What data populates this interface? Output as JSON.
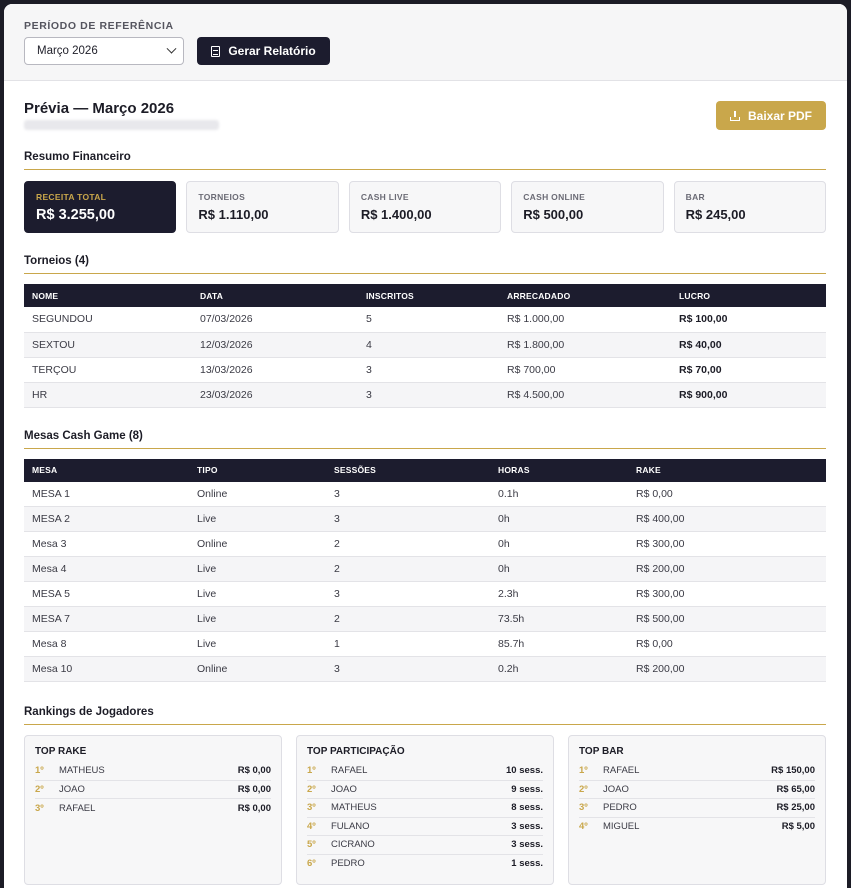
{
  "header": {
    "period_label": "PERÍODO DE REFERÊNCIA",
    "period_value": "Março 2026",
    "generate_label": "Gerar Relatório"
  },
  "preview": {
    "title": "Prévia — Março 2026",
    "pdf_label": "Baixar PDF"
  },
  "summary": {
    "title": "Resumo Financeiro",
    "cards": [
      {
        "label": "RECEITA TOTAL",
        "value": "R$ 3.255,00"
      },
      {
        "label": "TORNEIOS",
        "value": "R$ 1.110,00"
      },
      {
        "label": "CASH LIVE",
        "value": "R$ 1.400,00"
      },
      {
        "label": "CASH ONLINE",
        "value": "R$ 500,00"
      },
      {
        "label": "BAR",
        "value": "R$ 245,00"
      }
    ]
  },
  "tournaments": {
    "title": "Torneios (4)",
    "headers": [
      "NOME",
      "DATA",
      "INSCRITOS",
      "ARRECADADO",
      "LUCRO"
    ],
    "rows": [
      [
        "SEGUNDOU",
        "07/03/2026",
        "5",
        "R$ 1.000,00",
        "R$ 100,00"
      ],
      [
        "SEXTOU",
        "12/03/2026",
        "4",
        "R$ 1.800,00",
        "R$ 40,00"
      ],
      [
        "TERÇOU",
        "13/03/2026",
        "3",
        "R$ 700,00",
        "R$ 70,00"
      ],
      [
        "HR",
        "23/03/2026",
        "3",
        "R$ 4.500,00",
        "R$ 900,00"
      ]
    ]
  },
  "cash_tables": {
    "title": "Mesas Cash Game (8)",
    "headers": [
      "MESA",
      "TIPO",
      "SESSÕES",
      "HORAS",
      "RAKE"
    ],
    "rows": [
      [
        "MESA 1",
        "Online",
        "3",
        "0.1h",
        "R$ 0,00"
      ],
      [
        "MESA 2",
        "Live",
        "3",
        "0h",
        "R$ 400,00"
      ],
      [
        "Mesa 3",
        "Online",
        "2",
        "0h",
        "R$ 300,00"
      ],
      [
        "Mesa 4",
        "Live",
        "2",
        "0h",
        "R$ 200,00"
      ],
      [
        "MESA 5",
        "Live",
        "3",
        "2.3h",
        "R$ 300,00"
      ],
      [
        "MESA 7",
        "Live",
        "2",
        "73.5h",
        "R$ 500,00"
      ],
      [
        "Mesa 8",
        "Live",
        "1",
        "85.7h",
        "R$ 0,00"
      ],
      [
        "Mesa 10",
        "Online",
        "3",
        "0.2h",
        "R$ 200,00"
      ]
    ]
  },
  "rankings": {
    "title": "Rankings de Jogadores",
    "boxes": [
      {
        "title": "TOP RAKE",
        "rows": [
          {
            "pos": "1º",
            "name": "MATHEUS",
            "value": "R$ 0,00"
          },
          {
            "pos": "2º",
            "name": "JOAO",
            "value": "R$ 0,00"
          },
          {
            "pos": "3º",
            "name": "RAFAEL",
            "value": "R$ 0,00"
          }
        ]
      },
      {
        "title": "TOP PARTICIPAÇÃO",
        "rows": [
          {
            "pos": "1º",
            "name": "RAFAEL",
            "value": "10 sess."
          },
          {
            "pos": "2º",
            "name": "JOAO",
            "value": "9 sess."
          },
          {
            "pos": "3º",
            "name": "MATHEUS",
            "value": "8 sess."
          },
          {
            "pos": "4º",
            "name": "FULANO",
            "value": "3 sess."
          },
          {
            "pos": "5º",
            "name": "CICRANO",
            "value": "3 sess."
          },
          {
            "pos": "6º",
            "name": "PEDRO",
            "value": "1 sess."
          }
        ]
      },
      {
        "title": "TOP BAR",
        "rows": [
          {
            "pos": "1º",
            "name": "RAFAEL",
            "value": "R$ 150,00"
          },
          {
            "pos": "2º",
            "name": "JOAO",
            "value": "R$ 65,00"
          },
          {
            "pos": "3º",
            "name": "PEDRO",
            "value": "R$ 25,00"
          },
          {
            "pos": "4º",
            "name": "MIGUEL",
            "value": "R$ 5,00"
          }
        ]
      }
    ]
  }
}
